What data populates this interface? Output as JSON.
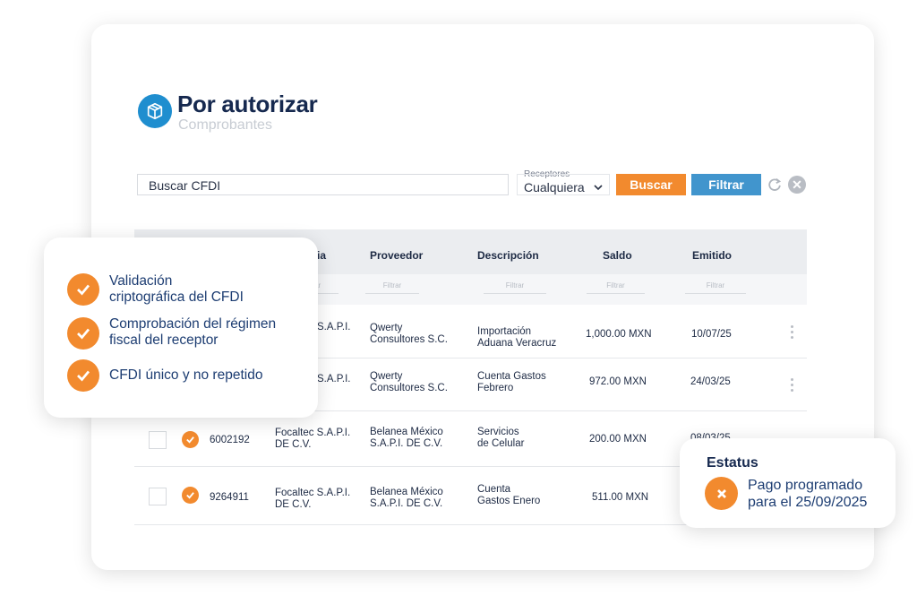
{
  "header": {
    "title": "Por autorizar",
    "subtitle": "Comprobantes"
  },
  "search": {
    "value": "Buscar CFDI"
  },
  "receptores": {
    "label": "Receptores",
    "selected": "Cualquiera"
  },
  "toolbar": {
    "buscar_label": "Buscar",
    "filtrar_label": "Filtrar"
  },
  "table": {
    "columns": [
      "ia",
      "Proveedor",
      "Descripción",
      "Saldo",
      "Emitido"
    ],
    "filter_placeholder": "Filtrar",
    "rows": [
      {
        "id": "",
        "emisor": [
          "",
          "S.A.P.I."
        ],
        "proveedor": [
          "Qwerty",
          "Consultores S.C."
        ],
        "descripcion": [
          "Importación",
          "Aduana Veracruz"
        ],
        "saldo": "1,000.00 MXN",
        "emitido": "10/07/25"
      },
      {
        "id": "",
        "emisor": [
          "",
          "S.A.P.I."
        ],
        "proveedor": [
          "Qwerty",
          "Consultores S.C."
        ],
        "descripcion": [
          "Cuenta Gastos",
          "Febrero"
        ],
        "saldo": "972.00 MXN",
        "emitido": "24/03/25"
      },
      {
        "id": "6002192",
        "emisor": [
          "Focaltec S.A.P.I.",
          "DE C.V."
        ],
        "proveedor": [
          "Belanea México",
          "S.A.P.I. DE C.V."
        ],
        "descripcion": [
          "Servicios",
          "de Celular"
        ],
        "saldo": "200.00 MXN",
        "emitido": "08/03/25"
      },
      {
        "id": "9264911",
        "emisor": [
          "Focaltec S.A.P.I.",
          "DE C.V."
        ],
        "proveedor": [
          "Belanea México",
          "S.A.P.I. DE C.V."
        ],
        "descripcion": [
          "Cuenta",
          "Gastos Enero"
        ],
        "saldo": "511.00 MXN",
        "emitido": ""
      }
    ]
  },
  "checks": [
    [
      "Validación",
      "criptográfica del CFDI"
    ],
    [
      "Comprobación del régimen",
      "fiscal del receptor"
    ],
    [
      "CFDI único y no repetido"
    ]
  ],
  "status": {
    "title": "Estatus",
    "text": [
      "Pago programado",
      "para el 25/09/2025"
    ]
  },
  "colors": {
    "orange": "#f28a2e",
    "blue": "#4195cd",
    "navy": "#16294f"
  }
}
